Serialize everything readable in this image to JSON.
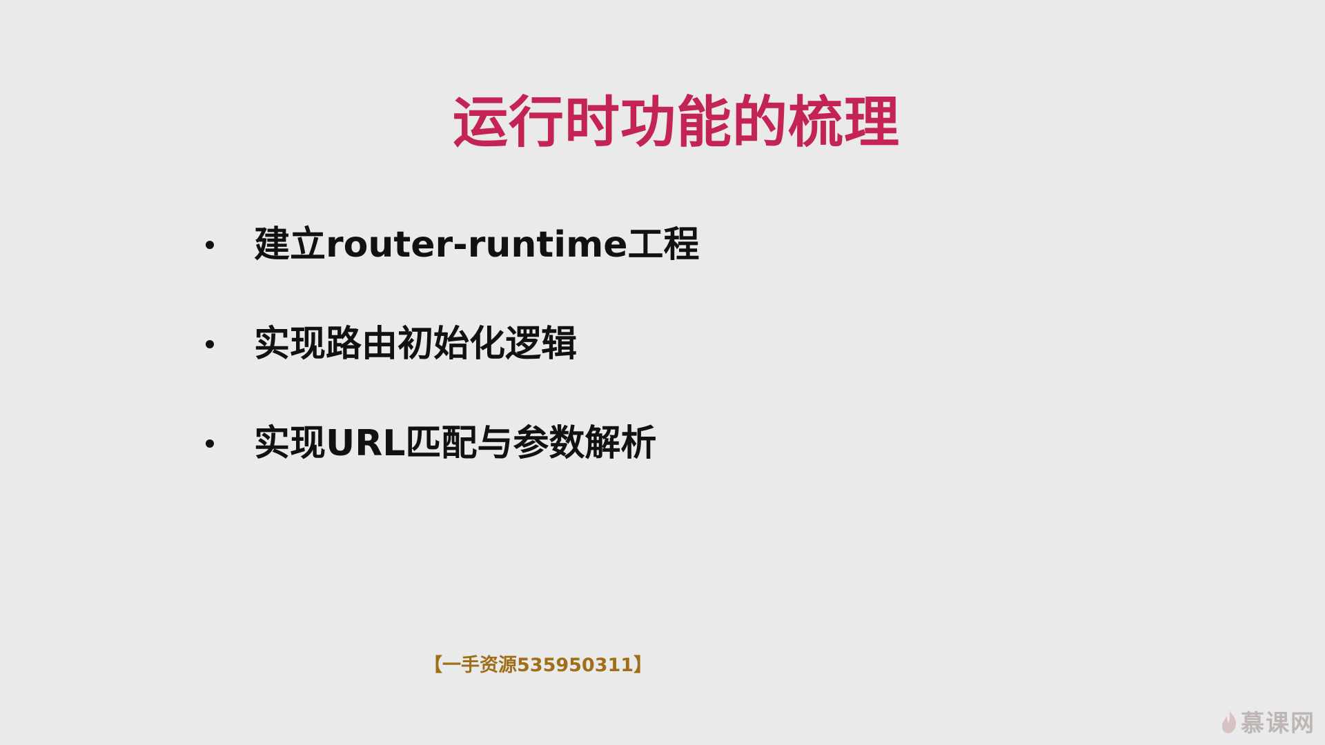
{
  "slide": {
    "title": "运行时功能的梳理",
    "bullets": [
      "建立router-runtime工程",
      "实现路由初始化逻辑",
      "实现URL匹配与参数解析"
    ],
    "watermark": "【一手资源535950311】",
    "logo": {
      "text": "慕课网",
      "icon": "flame-icon"
    }
  },
  "colors": {
    "background": "#ebeaea",
    "title": "#c32453",
    "text": "#111111",
    "watermark": "#a06e18"
  }
}
